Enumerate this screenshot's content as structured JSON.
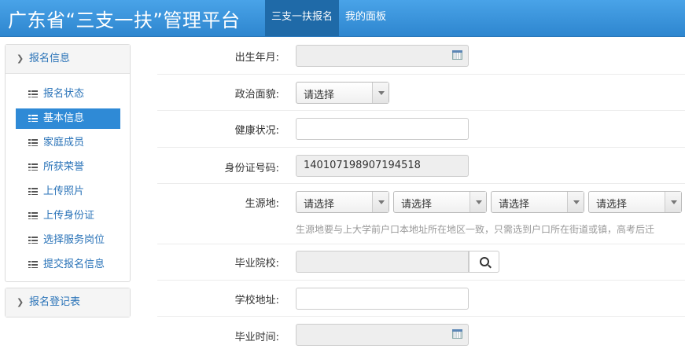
{
  "header": {
    "title": "广东省“三支一扶”管理平台",
    "nav": [
      {
        "label": "三支一扶报名",
        "active": true
      },
      {
        "label": "我的面板",
        "active": false
      }
    ]
  },
  "sidebar": {
    "panel1": {
      "title": "报名信息",
      "items": [
        {
          "label": "报名状态"
        },
        {
          "label": "基本信息"
        },
        {
          "label": "家庭成员"
        },
        {
          "label": "所获荣誉"
        },
        {
          "label": "上传照片"
        },
        {
          "label": "上传身份证"
        },
        {
          "label": "选择服务岗位"
        },
        {
          "label": "提交报名信息"
        }
      ]
    },
    "panel2": {
      "title": "报名登记表"
    }
  },
  "form": {
    "birth": {
      "label": "出生年月:",
      "value": ""
    },
    "political": {
      "label": "政治面貌:",
      "value": "请选择"
    },
    "health": {
      "label": "健康状况:",
      "value": ""
    },
    "idcard": {
      "label": "身份证号码:",
      "value": "140107198907194518"
    },
    "origin": {
      "label": "生源地:",
      "selects": [
        "请选择",
        "请选择",
        "请选择",
        "请选择"
      ],
      "hint": "生源地要与上大学前户口本地址所在地区一致，只需选到户口所在街道或镇，高考后迁"
    },
    "school": {
      "label": "毕业院校:",
      "value": ""
    },
    "school_address": {
      "label": "学校地址:",
      "value": ""
    },
    "grad_time": {
      "label": "毕业时间:",
      "value": ""
    }
  },
  "colors": {
    "accent": "#2f8ad6",
    "header": "#3c93d9",
    "link": "#2a73b8"
  }
}
